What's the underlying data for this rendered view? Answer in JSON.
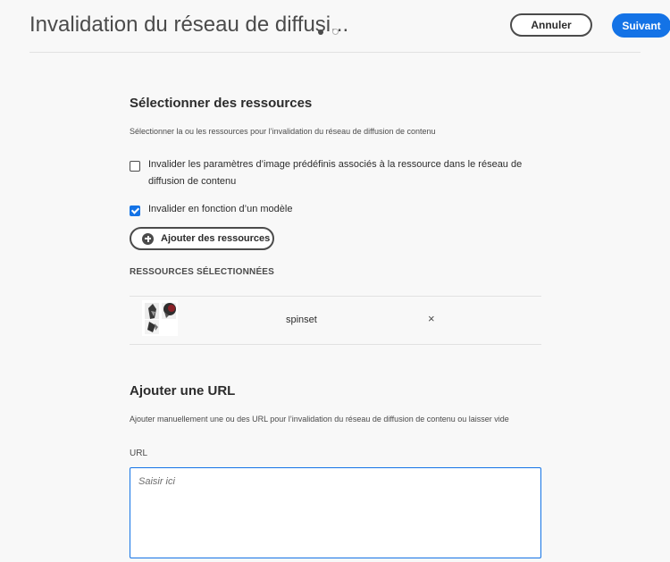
{
  "header": {
    "title": "Invalidation du réseau de diffusi...",
    "cancel_label": "Annuler",
    "next_label": "Suivant"
  },
  "select_resources": {
    "heading": "Sélectionner des ressources",
    "description": "Sélectionner la ou les ressources pour l’invalidation du réseau de diffusion de contenu",
    "option_presets_label": "Invalider les paramètres d’image prédéfinis associés à la ressource dans le réseau de diffusion de contenu",
    "option_presets_checked": false,
    "option_template_label": "Invalider en fonction d’un modèle",
    "option_template_checked": true,
    "add_button_label": "Ajouter des ressources",
    "selected_heading": "RESSOURCES SÉLECTIONNÉES",
    "selected_items": [
      {
        "name": "spinset",
        "remove_icon": "×"
      }
    ]
  },
  "add_url": {
    "heading": "Ajouter une URL",
    "description": "Ajouter manuellement une ou des URL pour l’invalidation du réseau de diffusion de contenu ou laisser vide",
    "field_label": "URL",
    "placeholder": "Saisir ici",
    "value": ""
  },
  "colors": {
    "accent": "#1473e6",
    "text": "#2c2c2c",
    "background": "#f8f8f8"
  }
}
